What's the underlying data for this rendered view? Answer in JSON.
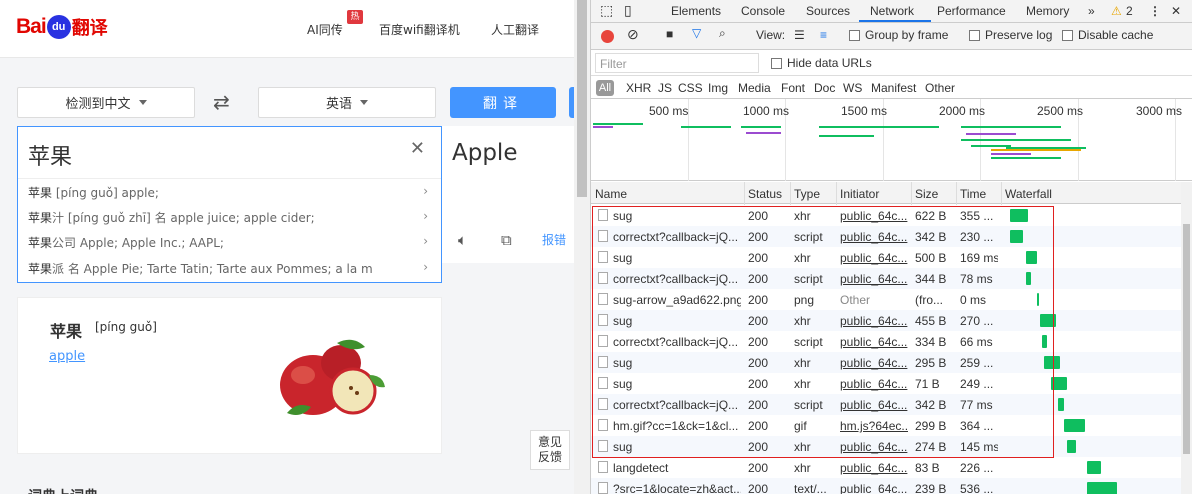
{
  "translator": {
    "logo": {
      "bai": "Bai",
      "du": "du",
      "fanyi": "翻译"
    },
    "nav": [
      "AI同传",
      "百度wifi翻译机",
      "人工翻译"
    ],
    "hot_badge": "热",
    "source_lang": "检测到中文",
    "target_lang": "英语",
    "translate_button": "翻译",
    "input_text": "苹果",
    "output_text": "Apple",
    "report_link": "报错",
    "suggestions": [
      {
        "key": "苹果",
        "rest": "   [píng guǒ] apple;"
      },
      {
        "key": "苹果",
        "rest": "汁    [píng guǒ zhī] 名 apple juice; apple cider;"
      },
      {
        "key": "苹果",
        "rest": "公司    Apple; Apple Inc.; AAPL;"
      },
      {
        "key": "苹果",
        "rest": "派    名 Apple Pie; Tarte Tatin; Tarte aux Pommes; a la m"
      }
    ],
    "dict_word": "苹果",
    "dict_pinyin": "[píng guǒ]",
    "dict_link": "apple",
    "feedback": "意见\n反馈",
    "more_title": "词典上词典"
  },
  "devtools": {
    "tabs": [
      "Elements",
      "Console",
      "Sources",
      "Network",
      "Performance",
      "Memory"
    ],
    "active_tab": "Network",
    "warning_count": "2",
    "toolbar": {
      "view_label": "View:",
      "group_by_frame": "Group by frame",
      "preserve_log": "Preserve log",
      "disable_cache": "Disable cache"
    },
    "filter_placeholder": "Filter",
    "hide_data_urls": "Hide data URLs",
    "types": [
      "All",
      "XHR",
      "JS",
      "CSS",
      "Img",
      "Media",
      "Font",
      "Doc",
      "WS",
      "Manifest",
      "Other"
    ],
    "overview_ticks": [
      "500 ms",
      "1000 ms",
      "1500 ms",
      "2000 ms",
      "2500 ms",
      "3000 ms"
    ],
    "columns": [
      "Name",
      "Status",
      "Type",
      "Initiator",
      "Size",
      "Time",
      "Waterfall"
    ],
    "rows": [
      {
        "name": "sug",
        "status": "200",
        "type": "xhr",
        "initiator": "public_64c...",
        "size": "622 B",
        "time": "355 ...",
        "wf_start": 0.04,
        "wf_len": 0.1
      },
      {
        "name": "correctxt?callback=jQ...",
        "status": "200",
        "type": "script",
        "initiator": "public_64c...",
        "size": "342 B",
        "time": "230 ...",
        "wf_start": 0.04,
        "wf_len": 0.07
      },
      {
        "name": "sug",
        "status": "200",
        "type": "xhr",
        "initiator": "public_64c...",
        "size": "500 B",
        "time": "169 ms",
        "wf_start": 0.13,
        "wf_len": 0.06
      },
      {
        "name": "correctxt?callback=jQ...",
        "status": "200",
        "type": "script",
        "initiator": "public_64c...",
        "size": "344 B",
        "time": "78 ms",
        "wf_start": 0.13,
        "wf_len": 0.03
      },
      {
        "name": "sug-arrow_a9ad622.png",
        "status": "200",
        "type": "png",
        "initiator": "Other",
        "size": "(fro...",
        "time": "0 ms",
        "wf_start": 0.19,
        "wf_len": 0.01
      },
      {
        "name": "sug",
        "status": "200",
        "type": "xhr",
        "initiator": "public_64c...",
        "size": "455 B",
        "time": "270 ...",
        "wf_start": 0.21,
        "wf_len": 0.09
      },
      {
        "name": "correctxt?callback=jQ...",
        "status": "200",
        "type": "script",
        "initiator": "public_64c...",
        "size": "334 B",
        "time": "66 ms",
        "wf_start": 0.22,
        "wf_len": 0.03
      },
      {
        "name": "sug",
        "status": "200",
        "type": "xhr",
        "initiator": "public_64c...",
        "size": "295 B",
        "time": "259 ...",
        "wf_start": 0.23,
        "wf_len": 0.09
      },
      {
        "name": "sug",
        "status": "200",
        "type": "xhr",
        "initiator": "public_64c...",
        "size": "71 B",
        "time": "249 ...",
        "wf_start": 0.27,
        "wf_len": 0.09
      },
      {
        "name": "correctxt?callback=jQ...",
        "status": "200",
        "type": "script",
        "initiator": "public_64c...",
        "size": "342 B",
        "time": "77 ms",
        "wf_start": 0.31,
        "wf_len": 0.03
      },
      {
        "name": "hm.gif?cc=1&ck=1&cl...",
        "status": "200",
        "type": "gif",
        "initiator": "hm.js?64ec...",
        "size": "299 B",
        "time": "364 ...",
        "wf_start": 0.34,
        "wf_len": 0.12
      },
      {
        "name": "sug",
        "status": "200",
        "type": "xhr",
        "initiator": "public_64c...",
        "size": "274 B",
        "time": "145 ms",
        "wf_start": 0.36,
        "wf_len": 0.05
      },
      {
        "name": "langdetect",
        "status": "200",
        "type": "xhr",
        "initiator": "public_64c...",
        "size": "83 B",
        "time": "226 ...",
        "wf_start": 0.47,
        "wf_len": 0.08
      },
      {
        "name": "?src=1&locate=zh&act...",
        "status": "200",
        "type": "text/...",
        "initiator": "public_64c...",
        "size": "239 B",
        "time": "536 ...",
        "wf_start": 0.47,
        "wf_len": 0.17
      }
    ],
    "colors": {
      "accent": "#1a73e8",
      "record": "#e8453c",
      "wf_green": "#0fbe5f",
      "highlight": "#e02020"
    }
  }
}
